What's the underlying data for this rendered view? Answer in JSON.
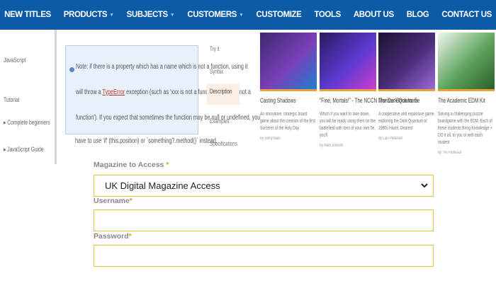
{
  "nav": {
    "items": [
      {
        "label": "NEW TITLES",
        "dropdown": false
      },
      {
        "label": "PRODUCTS",
        "dropdown": true
      },
      {
        "label": "SUBJECTS",
        "dropdown": true
      },
      {
        "label": "CUSTOMERS",
        "dropdown": true
      },
      {
        "label": "CUSTOMIZE",
        "dropdown": false
      },
      {
        "label": "TOOLS",
        "dropdown": false
      },
      {
        "label": "ABOUT US",
        "dropdown": false
      },
      {
        "label": "BLOG",
        "dropdown": false
      },
      {
        "label": "CONTACT US",
        "dropdown": false
      }
    ],
    "background": "#0d5aa7"
  },
  "background_page": {
    "left_links": [
      "JavaScript",
      "Tutorial",
      "▸ Complete beginners",
      "▸ JavaScript Guide"
    ],
    "notice": {
      "line1": "Note: if there is a property which has a name which is not a function, using it",
      "line2_pre": "will throw a ",
      "line2_link": "TypeError",
      "line2_post": " exception (such as 'xxx is not a function' or 'xxx is not a",
      "line3": "function'). If you expect that sometimes the function may be null or undefined, you",
      "line4": "have to use 'if' (this.position) or `something?.method()` instead."
    },
    "side_tabs": [
      "Try it",
      "Syntax",
      "Description",
      "Examples",
      "Specifications"
    ],
    "active_tab_index": 2
  },
  "products": [
    {
      "title": "Casting Shadows",
      "desc": "An innovative, strategic board game about the creation of the first Sorcerer of the Holy Day",
      "meta": "By Jenny Bailo",
      "colors": [
        "#3b2a6e",
        "#7a3fb8",
        "#1f7fd1"
      ]
    },
    {
      "title": "\"Fine, Mortals!\" - The NCCN Monster Book for 5e",
      "desc": "Which if you want to take down, you will be ready using them on the battlefield with tons of your own 5e, you'll",
      "meta": "By Mark Johnson",
      "colors": [
        "#2a1a5e",
        "#5b3ad1",
        "#d23ccf"
      ]
    },
    {
      "title": "The Dark Quantum",
      "desc": "A cooperative and expansive game exploring the Dark Quantum of 1980s Hazel, Dearest",
      "meta": "By Lars Pedersen",
      "colors": [
        "#1c1333",
        "#4b2d7a",
        "#9b6bd8"
      ]
    },
    {
      "title": "The Academic EDM Kit",
      "desc": "Solving a challenging puzzle boardgame with the EDM. Each of these students Bring Knowledge + DO it all, to you or with each student",
      "meta": "By The Professor",
      "colors": [
        "#f0f4f0",
        "#5da35a",
        "#2e5d2c"
      ]
    }
  ],
  "form": {
    "magazine_label": "Magazine to Access",
    "magazine_value": "UK Digital Magazine Access",
    "username_label": "Username",
    "username_value": "",
    "password_label": "Password",
    "password_value": "",
    "required_mark": "*",
    "border_color": "#e3c433"
  }
}
